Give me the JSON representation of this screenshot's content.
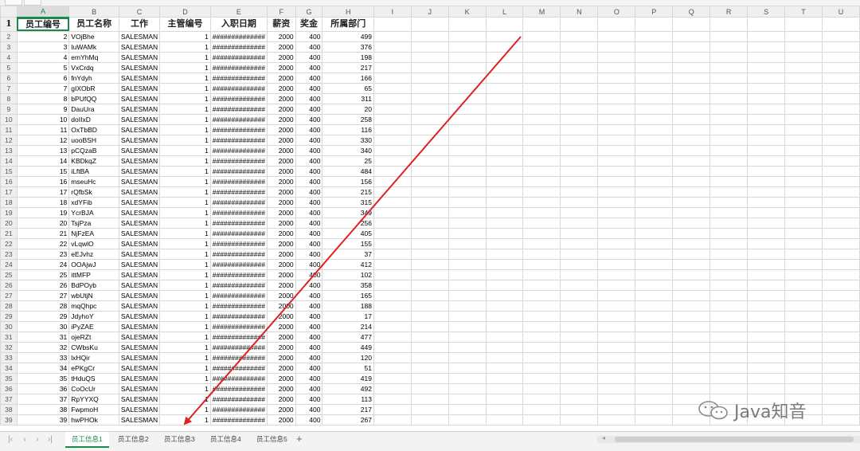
{
  "columns": [
    "A",
    "B",
    "C",
    "D",
    "E",
    "F",
    "G",
    "H",
    "I",
    "J",
    "K",
    "L",
    "M",
    "N",
    "O",
    "P",
    "Q",
    "R",
    "S",
    "T",
    "U"
  ],
  "header_row": [
    "员工编号",
    "员工名称",
    "工作",
    "主管编号",
    "入职日期",
    "薪资",
    "奖金",
    "所属部门"
  ],
  "rows": [
    [
      2,
      "VOjBhe",
      "SALESMAN",
      1,
      "##############",
      2000,
      400,
      499
    ],
    [
      3,
      "IuWAMk",
      "SALESMAN",
      1,
      "##############",
      2000,
      400,
      376
    ],
    [
      4,
      "emYhMq",
      "SALESMAN",
      1,
      "##############",
      2000,
      400,
      198
    ],
    [
      5,
      "VxCrdq",
      "SALESMAN",
      1,
      "##############",
      2000,
      400,
      217
    ],
    [
      6,
      "fnYdyh",
      "SALESMAN",
      1,
      "##############",
      2000,
      400,
      166
    ],
    [
      7,
      "gIXObR",
      "SALESMAN",
      1,
      "##############",
      2000,
      400,
      65
    ],
    [
      8,
      "bPUfQQ",
      "SALESMAN",
      1,
      "##############",
      2000,
      400,
      311
    ],
    [
      9,
      "DauUra",
      "SALESMAN",
      1,
      "##############",
      2000,
      400,
      20
    ],
    [
      10,
      "doIIxD",
      "SALESMAN",
      1,
      "##############",
      2000,
      400,
      258
    ],
    [
      11,
      "OxTbBD",
      "SALESMAN",
      1,
      "##############",
      2000,
      400,
      116
    ],
    [
      12,
      "uooBSH",
      "SALESMAN",
      1,
      "##############",
      2000,
      400,
      330
    ],
    [
      13,
      "pCQzaB",
      "SALESMAN",
      1,
      "##############",
      2000,
      400,
      340
    ],
    [
      14,
      "KBDkqZ",
      "SALESMAN",
      1,
      "##############",
      2000,
      400,
      25
    ],
    [
      15,
      "iLftBA",
      "SALESMAN",
      1,
      "##############",
      2000,
      400,
      484
    ],
    [
      16,
      "mseuHc",
      "SALESMAN",
      1,
      "##############",
      2000,
      400,
      156
    ],
    [
      17,
      "rQfbSk",
      "SALESMAN",
      1,
      "##############",
      2000,
      400,
      215
    ],
    [
      18,
      "xdYFib",
      "SALESMAN",
      1,
      "##############",
      2000,
      400,
      315
    ],
    [
      19,
      "YcrBJA",
      "SALESMAN",
      1,
      "##############",
      2000,
      400,
      349
    ],
    [
      20,
      "TsjPza",
      "SALESMAN",
      1,
      "##############",
      2000,
      400,
      256
    ],
    [
      21,
      "NjFzEA",
      "SALESMAN",
      1,
      "##############",
      2000,
      400,
      405
    ],
    [
      22,
      "vLqwlO",
      "SALESMAN",
      1,
      "##############",
      2000,
      400,
      155
    ],
    [
      23,
      "eEJvhz",
      "SALESMAN",
      1,
      "##############",
      2000,
      400,
      37
    ],
    [
      24,
      "OOAjwJ",
      "SALESMAN",
      1,
      "##############",
      2000,
      400,
      412
    ],
    [
      25,
      "ittMFP",
      "SALESMAN",
      1,
      "##############",
      2000,
      400,
      102
    ],
    [
      26,
      "BdPOyb",
      "SALESMAN",
      1,
      "##############",
      2000,
      400,
      358
    ],
    [
      27,
      "wbUtjN",
      "SALESMAN",
      1,
      "##############",
      2000,
      400,
      165
    ],
    [
      28,
      "mqQhpc",
      "SALESMAN",
      1,
      "##############",
      2000,
      400,
      188
    ],
    [
      29,
      "JdyhoY",
      "SALESMAN",
      1,
      "##############",
      2000,
      400,
      17
    ],
    [
      30,
      "iPyZAE",
      "SALESMAN",
      1,
      "##############",
      2000,
      400,
      214
    ],
    [
      31,
      "ojeRZt",
      "SALESMAN",
      1,
      "##############",
      2000,
      400,
      477
    ],
    [
      32,
      "CWbsKu",
      "SALESMAN",
      1,
      "##############",
      2000,
      400,
      449
    ],
    [
      33,
      "lxHQir",
      "SALESMAN",
      1,
      "##############",
      2000,
      400,
      120
    ],
    [
      34,
      "ePKgCr",
      "SALESMAN",
      1,
      "##############",
      2000,
      400,
      51
    ],
    [
      35,
      "tHduQS",
      "SALESMAN",
      1,
      "##############",
      2000,
      400,
      419
    ],
    [
      36,
      "CoOcUr",
      "SALESMAN",
      1,
      "##############",
      2000,
      400,
      492
    ],
    [
      37,
      "RpYYXQ",
      "SALESMAN",
      1,
      "##############",
      2000,
      400,
      113
    ],
    [
      38,
      "FwpmoH",
      "SALESMAN",
      1,
      "##############",
      2000,
      400,
      217
    ],
    [
      39,
      "hwPHOk",
      "SALESMAN",
      1,
      "##############",
      2000,
      400,
      267
    ]
  ],
  "sheet_tabs": [
    "员工信息1",
    "员工信息2",
    "员工信息3",
    "员工信息4",
    "员工信息5"
  ],
  "active_tab": 0,
  "add_tab_label": "+",
  "nav_icons": [
    "first-sheet-icon",
    "prev-sheet-icon",
    "next-sheet-icon",
    "last-sheet-icon"
  ],
  "watermark_text": "Java知音",
  "colors": {
    "accent": "#1a8a4a",
    "annotation_arrow": "#e02020",
    "header_bg": "#efefef",
    "grid_line": "#d8d8d8"
  }
}
